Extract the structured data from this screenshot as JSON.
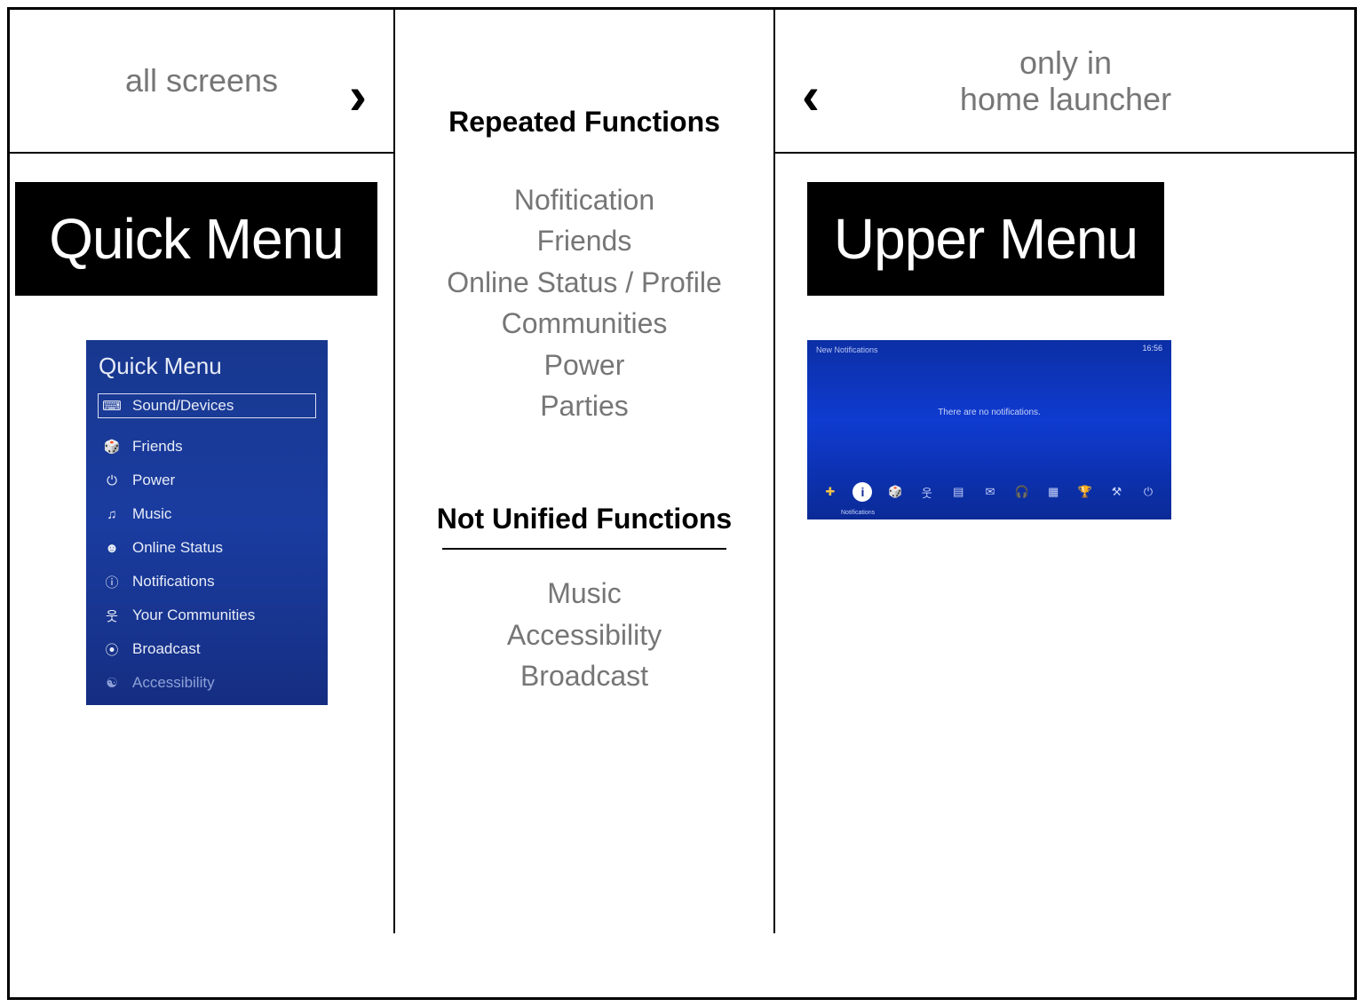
{
  "left": {
    "top_label": "all screens",
    "title": "Quick Menu",
    "quick_menu": {
      "heading": "Quick Menu",
      "items": [
        {
          "icon": "keyboard-icon",
          "glyph": "⌨",
          "label": "Sound/Devices",
          "selected": true
        },
        {
          "icon": "friends-icon",
          "glyph": "🎲",
          "label": "Friends"
        },
        {
          "icon": "power-icon",
          "glyph": "⏻",
          "label": "Power"
        },
        {
          "icon": "music-icon",
          "glyph": "♫",
          "label": "Music"
        },
        {
          "icon": "status-icon",
          "glyph": "☻",
          "label": "Online Status"
        },
        {
          "icon": "notify-icon",
          "glyph": "ⓘ",
          "label": "Notifications"
        },
        {
          "icon": "community-icon",
          "glyph": "웃",
          "label": "Your Communities"
        },
        {
          "icon": "broadcast-icon",
          "glyph": "⦿",
          "label": "Broadcast"
        },
        {
          "icon": "access-icon",
          "glyph": "☯",
          "label": "Accessibility",
          "dim": true
        }
      ]
    }
  },
  "center": {
    "heading1": "Repeated Functions",
    "list1": [
      "Nofitication",
      "Friends",
      "Online Status / Profile",
      "Communities",
      "Power",
      "Parties"
    ],
    "heading2": "Not Unified Functions",
    "list2": [
      "Music",
      "Accessibility",
      "Broadcast"
    ]
  },
  "right": {
    "top_label": "only in\nhome launcher",
    "title": "Upper Menu",
    "upper_menu": {
      "header": "New Notifications",
      "clock": "16:56",
      "message": "There are no notifications.",
      "selected_label": "Notifications",
      "icons": [
        {
          "name": "psplus-icon",
          "glyph": "✚",
          "klass": "plus"
        },
        {
          "name": "notify-icon",
          "glyph": "i",
          "selected": true
        },
        {
          "name": "friends-icon",
          "glyph": "🎲"
        },
        {
          "name": "community-icon",
          "glyph": "웃"
        },
        {
          "name": "events-icon",
          "glyph": "▤"
        },
        {
          "name": "messages-icon",
          "glyph": "✉"
        },
        {
          "name": "party-icon",
          "glyph": "🎧"
        },
        {
          "name": "profile-icon",
          "glyph": "▦"
        },
        {
          "name": "trophy-icon",
          "glyph": "🏆"
        },
        {
          "name": "settings-icon",
          "glyph": "⚒"
        },
        {
          "name": "power-icon",
          "glyph": "⏻"
        }
      ]
    }
  }
}
